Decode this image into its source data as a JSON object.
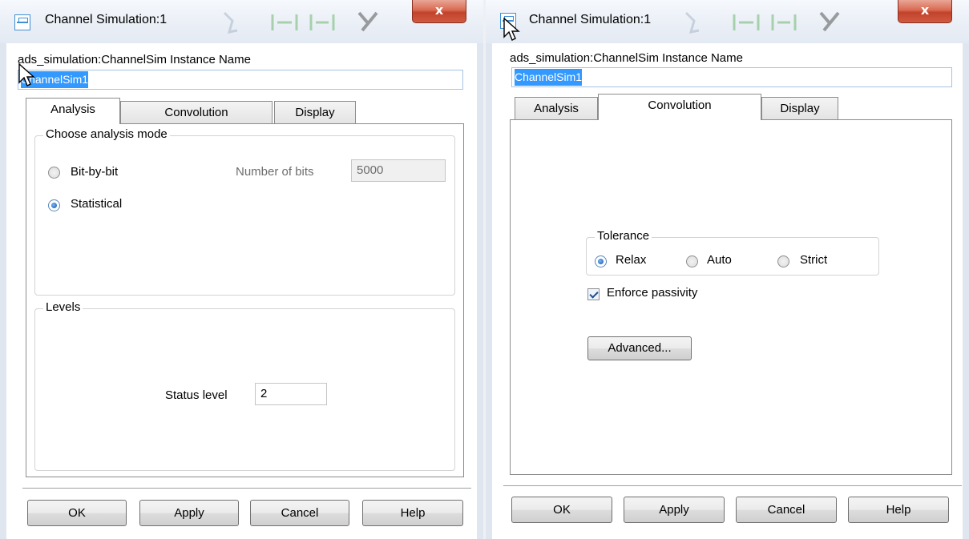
{
  "left_dialog": {
    "title": "Channel Simulation:1",
    "close_label": "x",
    "instance_label": "ads_simulation:ChannelSim Instance Name",
    "instance_value": "ChannelSim1",
    "tabs": [
      "Analysis",
      "Convolution",
      "Display"
    ],
    "active_tab": "Analysis",
    "analysis_mode": {
      "legend": "Choose analysis mode",
      "options": [
        "Bit-by-bit",
        "Statistical"
      ],
      "selected": "Statistical",
      "bits_label": "Number of bits",
      "bits_value": "5000"
    },
    "levels": {
      "legend": "Levels",
      "status_label": "Status level",
      "status_value": "2"
    },
    "buttons": [
      "OK",
      "Apply",
      "Cancel",
      "Help"
    ]
  },
  "right_dialog": {
    "title": "Channel Simulation:1",
    "close_label": "x",
    "instance_label": "ads_simulation:ChannelSim Instance Name",
    "instance_value": "ChannelSim1",
    "tabs": [
      "Analysis",
      "Convolution",
      "Display"
    ],
    "active_tab": "Convolution",
    "tolerance": {
      "legend": "Tolerance",
      "options": [
        "Relax",
        "Auto",
        "Strict"
      ],
      "selected": "Relax"
    },
    "enforce_passivity_label": "Enforce passivity",
    "enforce_passivity_checked": true,
    "advanced_label": "Advanced...",
    "buttons": [
      "OK",
      "Apply",
      "Cancel",
      "Help"
    ]
  },
  "icons": {
    "window": "channel-sim-window-icon",
    "pointer": "mouse-pointer-icon"
  },
  "colors": {
    "selection": "#3399ff",
    "close_button": "#c2422b",
    "radio_selected": "#2a6fc1"
  }
}
